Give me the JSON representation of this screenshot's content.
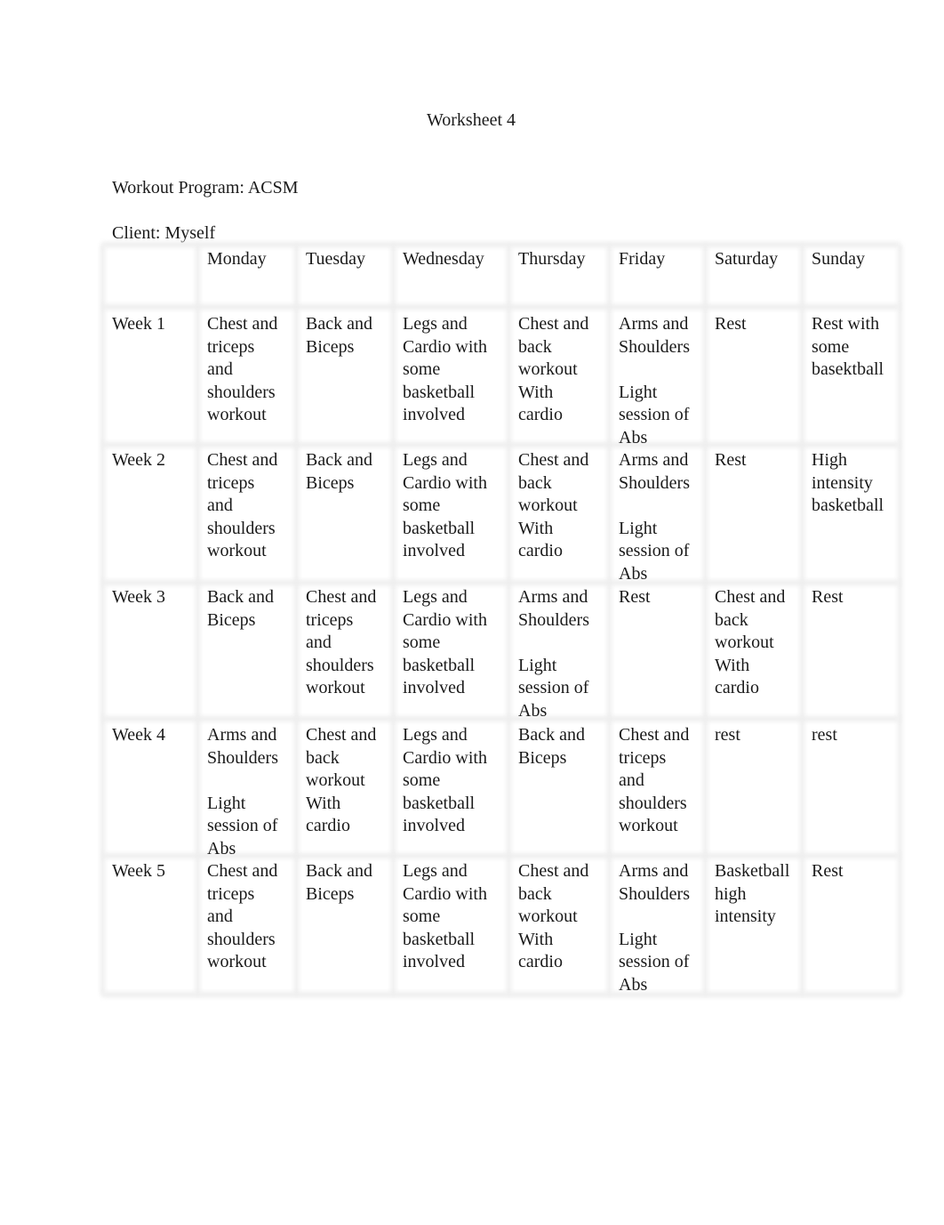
{
  "document": {
    "title": "Worksheet 4",
    "program_label": "Workout Program: ACSM",
    "client_label": "Client: Myself"
  },
  "table": {
    "headers": [
      "",
      "Monday",
      "Tuesday",
      "Wednesday",
      "Thursday",
      "Friday",
      "Saturday",
      "Sunday"
    ],
    "rows": [
      {
        "label": "Week 1",
        "cells": [
          "Chest and\ntriceps\nand\nshoulders\nworkout",
          "Back and\nBiceps",
          "Legs and\nCardio with\nsome\nbasketball\ninvolved",
          "Chest and\nback\nworkout\nWith\ncardio",
          "Arms and\nShoulders\n\nLight\nsession of\nAbs",
          "Rest",
          "Rest with\nsome\nbasektball"
        ]
      },
      {
        "label": "Week 2",
        "cells": [
          "Chest and\ntriceps\nand\nshoulders\nworkout",
          "Back and\nBiceps",
          "Legs and\nCardio with\nsome\nbasketball\ninvolved",
          "Chest and\nback\nworkout\nWith\ncardio",
          "Arms and\nShoulders\n\nLight\nsession of\nAbs",
          "Rest",
          "High\nintensity\nbasketball"
        ]
      },
      {
        "label": "Week 3",
        "cells": [
          "Back and\nBiceps",
          "Chest and\ntriceps\nand\nshoulders\nworkout",
          "Legs and\nCardio with\nsome\nbasketball\ninvolved",
          "Arms and\nShoulders\n\nLight\nsession of\nAbs",
          "Rest",
          "Chest and\nback\nworkout\nWith\ncardio",
          "Rest"
        ]
      },
      {
        "label": "Week 4",
        "cells": [
          "Arms and\nShoulders\n\nLight\nsession of\nAbs",
          "Chest and\nback\nworkout\nWith\ncardio",
          "Legs and\nCardio with\nsome\nbasketball\ninvolved",
          "Back and\nBiceps",
          "Chest and\ntriceps\nand\nshoulders\nworkout",
          "rest",
          "rest"
        ]
      },
      {
        "label": "Week 5",
        "cells": [
          "Chest and\ntriceps\nand\nshoulders\nworkout",
          "Back and\nBiceps",
          "Legs and\nCardio with\nsome\nbasketball\ninvolved",
          "Chest and\nback\nworkout\nWith\ncardio",
          "Arms and\nShoulders\n\nLight\nsession of\nAbs",
          "Basketball\nhigh\nintensity",
          "Rest"
        ]
      }
    ]
  }
}
